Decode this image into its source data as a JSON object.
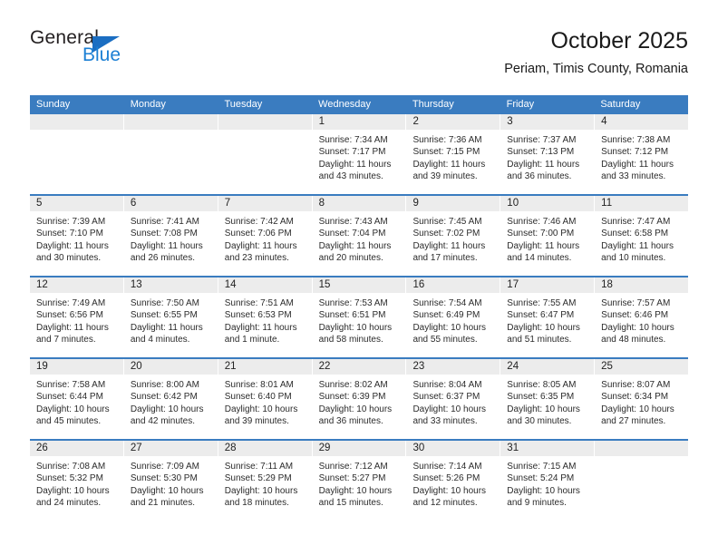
{
  "logo": {
    "text_top": "General",
    "text_bottom": "Blue",
    "triangle_color": "#1b6ec2",
    "blue_color": "#1b7fd4"
  },
  "header": {
    "title": "October 2025",
    "subtitle": "Periam, Timis County, Romania"
  },
  "theme": {
    "header_band": "#3a7cc0",
    "date_band": "#ececec",
    "cell_bg": "#ffffff",
    "text": "#2b2b2b"
  },
  "weekdays": [
    "Sunday",
    "Monday",
    "Tuesday",
    "Wednesday",
    "Thursday",
    "Friday",
    "Saturday"
  ],
  "weeks": [
    [
      {
        "day": "",
        "sunrise": "",
        "sunset": "",
        "daylight": ""
      },
      {
        "day": "",
        "sunrise": "",
        "sunset": "",
        "daylight": ""
      },
      {
        "day": "",
        "sunrise": "",
        "sunset": "",
        "daylight": ""
      },
      {
        "day": "1",
        "sunrise": "Sunrise: 7:34 AM",
        "sunset": "Sunset: 7:17 PM",
        "daylight": "Daylight: 11 hours and 43 minutes."
      },
      {
        "day": "2",
        "sunrise": "Sunrise: 7:36 AM",
        "sunset": "Sunset: 7:15 PM",
        "daylight": "Daylight: 11 hours and 39 minutes."
      },
      {
        "day": "3",
        "sunrise": "Sunrise: 7:37 AM",
        "sunset": "Sunset: 7:13 PM",
        "daylight": "Daylight: 11 hours and 36 minutes."
      },
      {
        "day": "4",
        "sunrise": "Sunrise: 7:38 AM",
        "sunset": "Sunset: 7:12 PM",
        "daylight": "Daylight: 11 hours and 33 minutes."
      }
    ],
    [
      {
        "day": "5",
        "sunrise": "Sunrise: 7:39 AM",
        "sunset": "Sunset: 7:10 PM",
        "daylight": "Daylight: 11 hours and 30 minutes."
      },
      {
        "day": "6",
        "sunrise": "Sunrise: 7:41 AM",
        "sunset": "Sunset: 7:08 PM",
        "daylight": "Daylight: 11 hours and 26 minutes."
      },
      {
        "day": "7",
        "sunrise": "Sunrise: 7:42 AM",
        "sunset": "Sunset: 7:06 PM",
        "daylight": "Daylight: 11 hours and 23 minutes."
      },
      {
        "day": "8",
        "sunrise": "Sunrise: 7:43 AM",
        "sunset": "Sunset: 7:04 PM",
        "daylight": "Daylight: 11 hours and 20 minutes."
      },
      {
        "day": "9",
        "sunrise": "Sunrise: 7:45 AM",
        "sunset": "Sunset: 7:02 PM",
        "daylight": "Daylight: 11 hours and 17 minutes."
      },
      {
        "day": "10",
        "sunrise": "Sunrise: 7:46 AM",
        "sunset": "Sunset: 7:00 PM",
        "daylight": "Daylight: 11 hours and 14 minutes."
      },
      {
        "day": "11",
        "sunrise": "Sunrise: 7:47 AM",
        "sunset": "Sunset: 6:58 PM",
        "daylight": "Daylight: 11 hours and 10 minutes."
      }
    ],
    [
      {
        "day": "12",
        "sunrise": "Sunrise: 7:49 AM",
        "sunset": "Sunset: 6:56 PM",
        "daylight": "Daylight: 11 hours and 7 minutes."
      },
      {
        "day": "13",
        "sunrise": "Sunrise: 7:50 AM",
        "sunset": "Sunset: 6:55 PM",
        "daylight": "Daylight: 11 hours and 4 minutes."
      },
      {
        "day": "14",
        "sunrise": "Sunrise: 7:51 AM",
        "sunset": "Sunset: 6:53 PM",
        "daylight": "Daylight: 11 hours and 1 minute."
      },
      {
        "day": "15",
        "sunrise": "Sunrise: 7:53 AM",
        "sunset": "Sunset: 6:51 PM",
        "daylight": "Daylight: 10 hours and 58 minutes."
      },
      {
        "day": "16",
        "sunrise": "Sunrise: 7:54 AM",
        "sunset": "Sunset: 6:49 PM",
        "daylight": "Daylight: 10 hours and 55 minutes."
      },
      {
        "day": "17",
        "sunrise": "Sunrise: 7:55 AM",
        "sunset": "Sunset: 6:47 PM",
        "daylight": "Daylight: 10 hours and 51 minutes."
      },
      {
        "day": "18",
        "sunrise": "Sunrise: 7:57 AM",
        "sunset": "Sunset: 6:46 PM",
        "daylight": "Daylight: 10 hours and 48 minutes."
      }
    ],
    [
      {
        "day": "19",
        "sunrise": "Sunrise: 7:58 AM",
        "sunset": "Sunset: 6:44 PM",
        "daylight": "Daylight: 10 hours and 45 minutes."
      },
      {
        "day": "20",
        "sunrise": "Sunrise: 8:00 AM",
        "sunset": "Sunset: 6:42 PM",
        "daylight": "Daylight: 10 hours and 42 minutes."
      },
      {
        "day": "21",
        "sunrise": "Sunrise: 8:01 AM",
        "sunset": "Sunset: 6:40 PM",
        "daylight": "Daylight: 10 hours and 39 minutes."
      },
      {
        "day": "22",
        "sunrise": "Sunrise: 8:02 AM",
        "sunset": "Sunset: 6:39 PM",
        "daylight": "Daylight: 10 hours and 36 minutes."
      },
      {
        "day": "23",
        "sunrise": "Sunrise: 8:04 AM",
        "sunset": "Sunset: 6:37 PM",
        "daylight": "Daylight: 10 hours and 33 minutes."
      },
      {
        "day": "24",
        "sunrise": "Sunrise: 8:05 AM",
        "sunset": "Sunset: 6:35 PM",
        "daylight": "Daylight: 10 hours and 30 minutes."
      },
      {
        "day": "25",
        "sunrise": "Sunrise: 8:07 AM",
        "sunset": "Sunset: 6:34 PM",
        "daylight": "Daylight: 10 hours and 27 minutes."
      }
    ],
    [
      {
        "day": "26",
        "sunrise": "Sunrise: 7:08 AM",
        "sunset": "Sunset: 5:32 PM",
        "daylight": "Daylight: 10 hours and 24 minutes."
      },
      {
        "day": "27",
        "sunrise": "Sunrise: 7:09 AM",
        "sunset": "Sunset: 5:30 PM",
        "daylight": "Daylight: 10 hours and 21 minutes."
      },
      {
        "day": "28",
        "sunrise": "Sunrise: 7:11 AM",
        "sunset": "Sunset: 5:29 PM",
        "daylight": "Daylight: 10 hours and 18 minutes."
      },
      {
        "day": "29",
        "sunrise": "Sunrise: 7:12 AM",
        "sunset": "Sunset: 5:27 PM",
        "daylight": "Daylight: 10 hours and 15 minutes."
      },
      {
        "day": "30",
        "sunrise": "Sunrise: 7:14 AM",
        "sunset": "Sunset: 5:26 PM",
        "daylight": "Daylight: 10 hours and 12 minutes."
      },
      {
        "day": "31",
        "sunrise": "Sunrise: 7:15 AM",
        "sunset": "Sunset: 5:24 PM",
        "daylight": "Daylight: 10 hours and 9 minutes."
      },
      {
        "day": "",
        "sunrise": "",
        "sunset": "",
        "daylight": ""
      }
    ]
  ]
}
